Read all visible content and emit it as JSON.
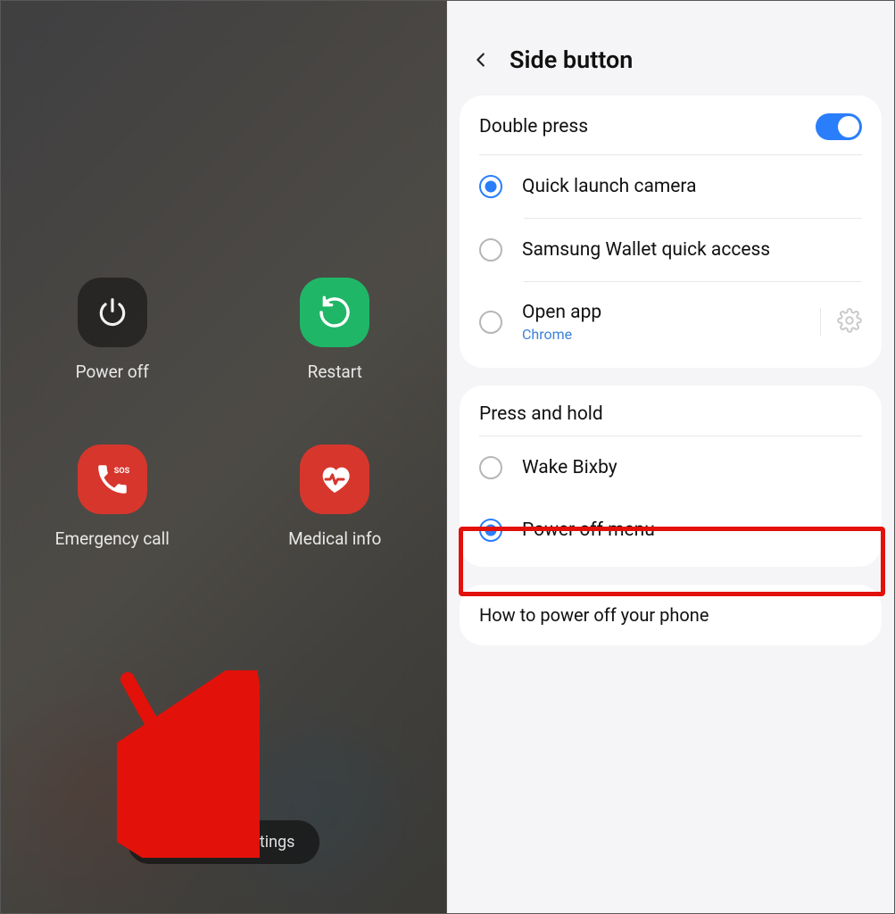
{
  "left": {
    "power_off": "Power off",
    "restart": "Restart",
    "emergency_call": "Emergency call",
    "medical_info": "Medical info",
    "bottom_button": "Side button settings"
  },
  "right": {
    "title": "Side button",
    "double_press": {
      "title": "Double press",
      "toggle_on": true,
      "options": {
        "camera": "Quick launch camera",
        "wallet": "Samsung Wallet quick access",
        "open_app": "Open app",
        "open_app_sub": "Chrome"
      }
    },
    "press_hold": {
      "title": "Press and hold",
      "options": {
        "bixby": "Wake Bixby",
        "power_off": "Power off menu"
      }
    },
    "how_to": "How to power off your phone"
  }
}
